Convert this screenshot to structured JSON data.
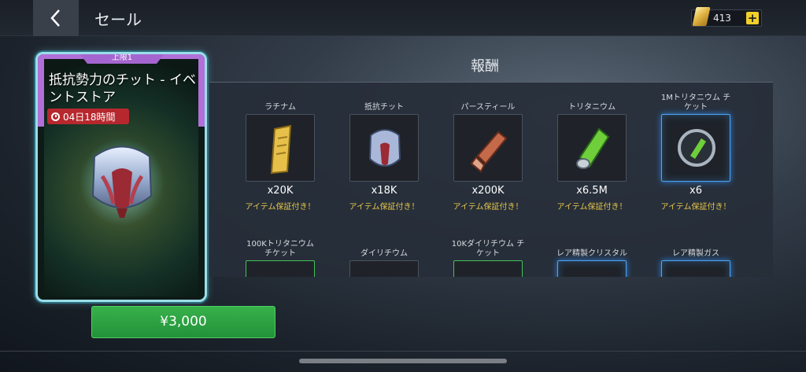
{
  "header": {
    "title": "セール",
    "currency_amount": "413"
  },
  "offer": {
    "limit_label": "上限1",
    "title": "抵抗勢力のチット - イベントストア",
    "timer": "04日18時間",
    "price": "¥3,000"
  },
  "rewards": {
    "title": "報酬",
    "items": [
      {
        "name": "ラチナム",
        "qty": "x20K",
        "note": "アイテム保証付き！",
        "icon": "latinum-bar-icon"
      },
      {
        "name": "抵抗チット",
        "qty": "x18K",
        "note": "アイテム保証付き！",
        "icon": "resistance-chit-icon"
      },
      {
        "name": "パースティール",
        "qty": "x200K",
        "note": "アイテム保証付き！",
        "icon": "parsteel-icon"
      },
      {
        "name": "トリタニウム",
        "qty": "x6.5M",
        "note": "アイテム保証付き！",
        "icon": "tritanium-icon"
      },
      {
        "name": "1Mトリタニウム チケット",
        "qty": "x6",
        "note": "アイテム保証付き！",
        "icon": "tritanium-token-icon"
      },
      {
        "name": "100Kトリタニウム チケット",
        "icon": "tritanium-token-icon"
      },
      {
        "name": "ダイリチウム",
        "icon": "dilithium-icon"
      },
      {
        "name": "10Kダイリチウム チケット",
        "icon": "dilithium-token-icon"
      },
      {
        "name": "レア精製クリスタル",
        "icon": "crystal-icon"
      },
      {
        "name": "レア精製ガス",
        "icon": "gas-icon"
      }
    ]
  },
  "colors": {
    "buy_button": "#2ea143",
    "timer_bg": "#b7282e",
    "guarantee_text": "#e6c74a"
  }
}
